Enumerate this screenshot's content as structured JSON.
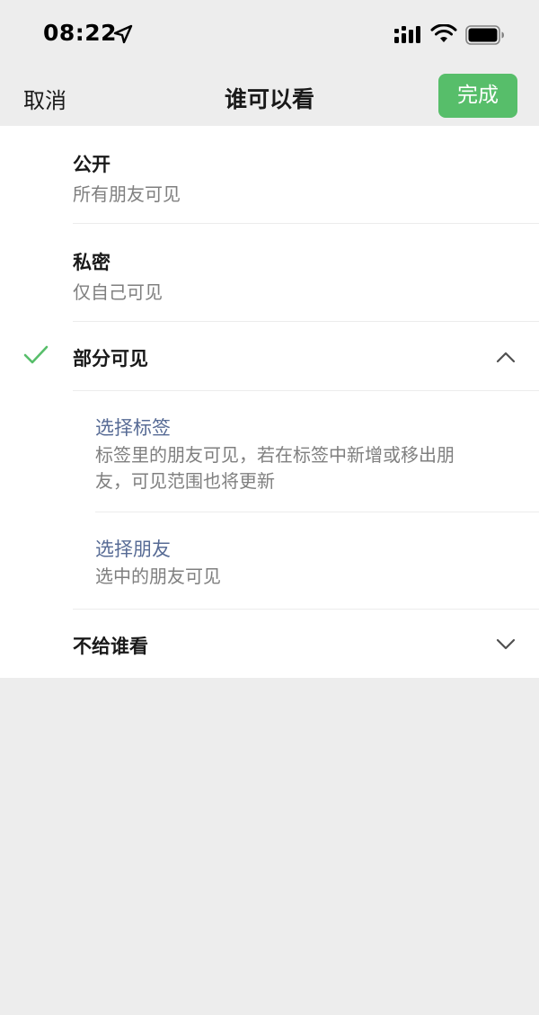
{
  "status_bar": {
    "time": "08:22",
    "icons": [
      "location-arrow-icon",
      "cellular-signal-icon",
      "wifi-icon",
      "battery-icon"
    ]
  },
  "nav": {
    "cancel_label": "取消",
    "title": "谁可以看",
    "done_label": "完成"
  },
  "options": {
    "public": {
      "title": "公开",
      "desc": "所有朋友可见"
    },
    "private": {
      "title": "私密",
      "desc": "仅自己可见"
    },
    "partial": {
      "title": "部分可见",
      "selected": true,
      "expanded": true,
      "select_tags": {
        "title": "选择标签",
        "desc": "标签里的朋友可见，若在标签中新增或移出朋友，可见范围也将更新"
      },
      "select_friends": {
        "title": "选择朋友",
        "desc": "选中的朋友可见"
      }
    },
    "exclude": {
      "title": "不给谁看",
      "expanded": false
    }
  },
  "colors": {
    "accent_green": "#57be6a",
    "link_blue": "#576b95",
    "background": "#ededed"
  }
}
